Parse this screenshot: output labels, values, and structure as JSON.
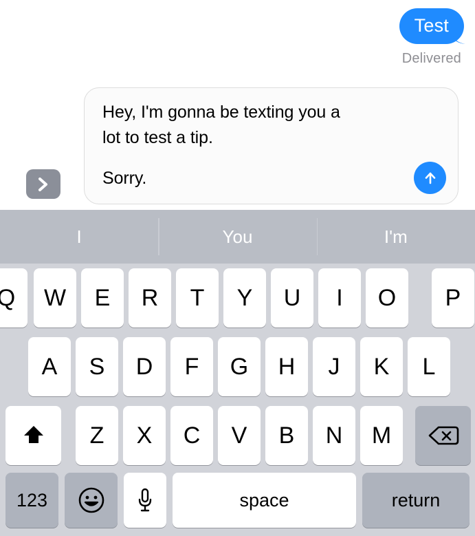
{
  "conversation": {
    "sent_message": {
      "text": "Test",
      "status": "Delivered",
      "bubble_color": "#1f8bff",
      "text_color": "#ffffff",
      "status_color": "#8e8e93"
    }
  },
  "input_bar": {
    "expand_button_icon": "chevron-right-icon",
    "expand_button_color": "#8b8f99",
    "compose_line_1": "Hey, I'm gonna be texting you a",
    "compose_line_2": "lot to test a tip.",
    "compose_line_3": "Sorry.",
    "send_button_icon": "arrow-up-icon",
    "send_button_color": "#1f8bff"
  },
  "keyboard": {
    "background_color": "#d1d3d9",
    "predictive": {
      "background_color": "#b9bdc5",
      "suggestions": [
        "I",
        "You",
        "I'm"
      ]
    },
    "row1": [
      "Q",
      "W",
      "E",
      "R",
      "T",
      "Y",
      "U",
      "I",
      "O",
      "P"
    ],
    "row2": [
      "A",
      "S",
      "D",
      "F",
      "G",
      "H",
      "J",
      "K",
      "L"
    ],
    "row3": {
      "shift_icon": "shift-arrow-up-icon",
      "letters": [
        "Z",
        "X",
        "C",
        "V",
        "B",
        "N",
        "M"
      ],
      "backspace_icon": "backspace-delete-icon"
    },
    "row4": {
      "numbers_label": "123",
      "emoji_icon": "smiley-face-icon",
      "dictation_icon": "microphone-icon",
      "space_label": "space",
      "return_label": "return"
    }
  }
}
